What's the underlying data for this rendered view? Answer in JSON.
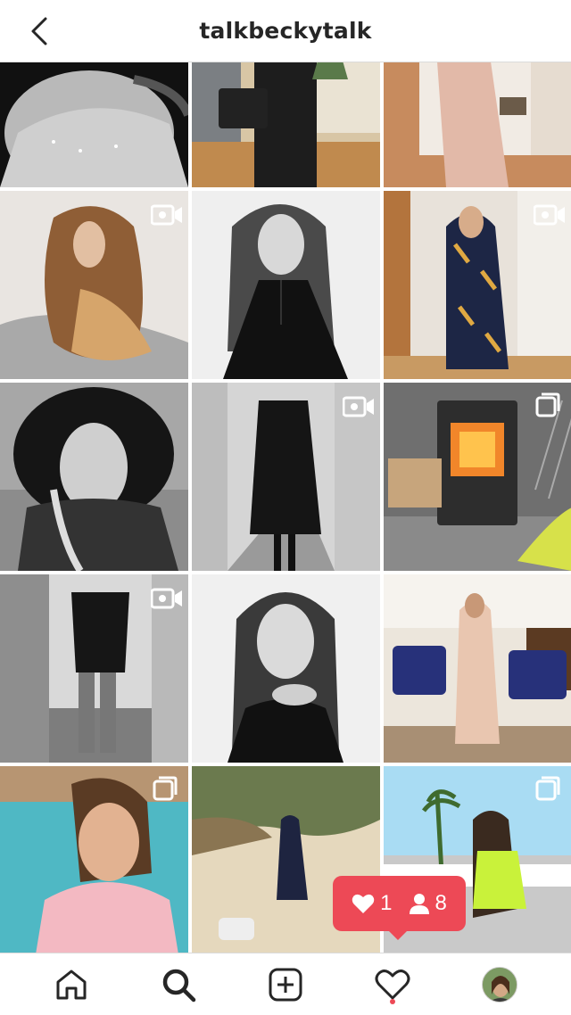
{
  "header": {
    "title": "talkbeckytalk",
    "back_icon": "chevron-left-icon"
  },
  "grid": {
    "tiles": [
      {
        "badge": "none",
        "desc_bg": "#1a1a1a"
      },
      {
        "badge": "none",
        "desc_bg": "#c9a57a"
      },
      {
        "badge": "none",
        "desc_bg": "#e3c9b4"
      },
      {
        "badge": "video",
        "desc_bg": "#b58a5e"
      },
      {
        "badge": "none",
        "desc_bg": "#eeeeee"
      },
      {
        "badge": "video",
        "desc_bg": "#caa37a"
      },
      {
        "badge": "none",
        "desc_bg": "#8f8f8f"
      },
      {
        "badge": "video",
        "desc_bg": "#b5b5b5"
      },
      {
        "badge": "carousel",
        "desc_bg": "#6b6b6b"
      },
      {
        "badge": "video",
        "desc_bg": "#9a9a9a"
      },
      {
        "badge": "none",
        "desc_bg": "#d8d8d8"
      },
      {
        "badge": "none",
        "desc_bg": "#c8b39b"
      },
      {
        "badge": "carousel",
        "desc_bg": "#3aa7b5"
      },
      {
        "badge": "none",
        "desc_bg": "#d7c49e"
      },
      {
        "badge": "carousel",
        "desc_bg": "#9fd4ee"
      }
    ]
  },
  "notification": {
    "likes": "1",
    "followers": "8",
    "color": "#ed4956"
  },
  "tabbar": {
    "items": [
      "home-icon",
      "search-icon",
      "add-post-icon",
      "activity-heart-icon",
      "profile-avatar"
    ]
  }
}
